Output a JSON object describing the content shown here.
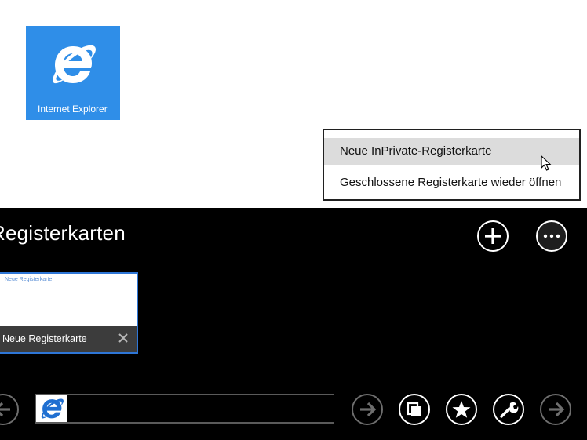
{
  "start_tile": {
    "label": "Internet Explorer",
    "icon": "internet-explorer-icon"
  },
  "context_menu": {
    "items": [
      {
        "label": "Neue InPrivate-Registerkarte",
        "hovered": true
      },
      {
        "label": "Geschlossene Registerkarte wieder öffnen",
        "hovered": false
      }
    ]
  },
  "tab_bar": {
    "title": "Registerkarten",
    "new_tab_icon": "plus-icon",
    "more_icon": "ellipsis-icon",
    "tabs": [
      {
        "preview_text": "Neue Registerkarte",
        "label": "Neue Registerkarte",
        "active": true
      }
    ]
  },
  "nav_bar": {
    "address_value": "",
    "icons": {
      "back": "back-arrow-icon",
      "go": "go-arrow-icon",
      "tabs": "tabs-icon",
      "favorites": "star-icon",
      "tools": "wrench-icon",
      "forward": "forward-arrow-icon"
    }
  },
  "colors": {
    "tile_blue": "#2f8ee8",
    "appbar_bg": "#000000",
    "tab_border": "#2e76d6",
    "menu_hover": "#dcdcdc"
  }
}
